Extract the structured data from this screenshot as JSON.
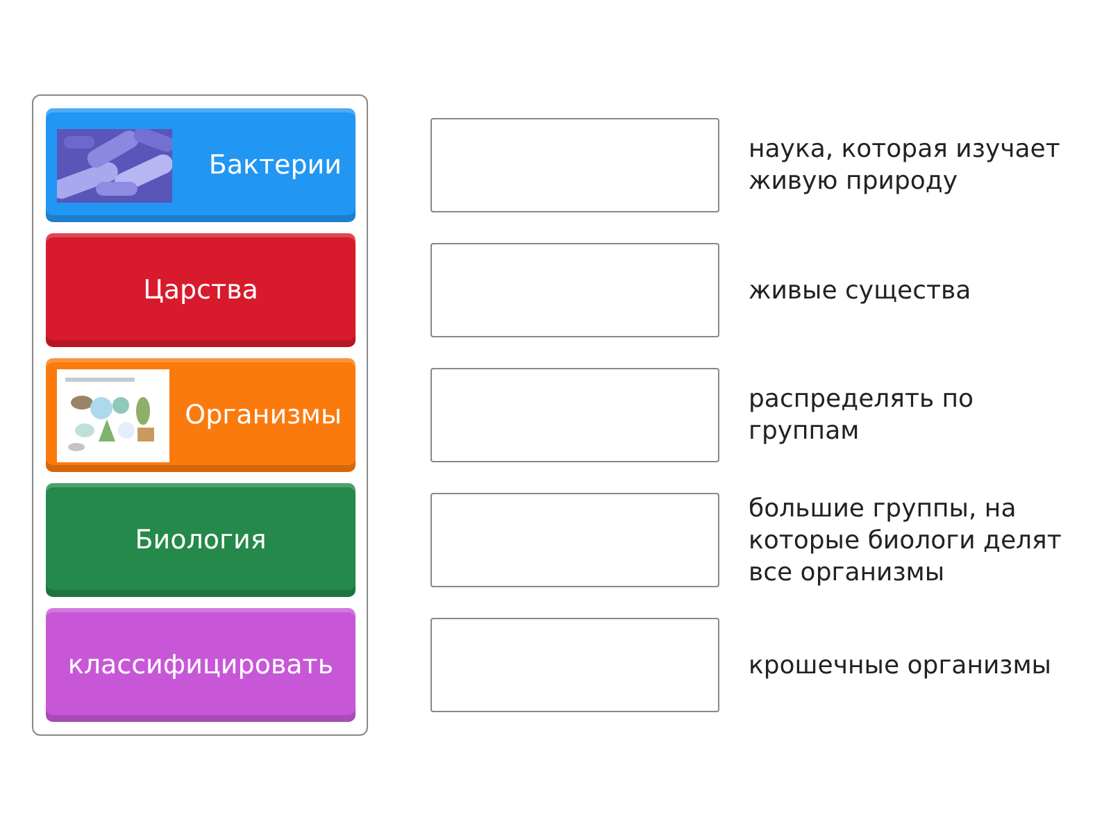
{
  "cards": [
    {
      "label": "Бактерии",
      "color": "#2196f3",
      "kind": "bacteria"
    },
    {
      "label": "Царства",
      "color": "#d81b2c",
      "kind": "text"
    },
    {
      "label": "Организмы",
      "color": "#fb7a0e",
      "kind": "organisms"
    },
    {
      "label": "Биология",
      "color": "#24894a",
      "kind": "text"
    },
    {
      "label": "классифицировать",
      "color": "#c857d8",
      "kind": "text"
    }
  ],
  "definitions": [
    "наука, которая изучает живую природу",
    "живые существа",
    "распределять по группам",
    "большие группы, на которые биологи делят все организмы",
    "крошечные организмы"
  ]
}
